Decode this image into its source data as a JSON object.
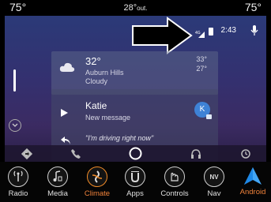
{
  "climate": {
    "left_temp": "75°",
    "right_temp": "75°",
    "outside_temp": "28°",
    "outside_label": "out."
  },
  "status": {
    "network": "4G",
    "time": "2:43"
  },
  "weather_card": {
    "temperature": "32°",
    "location": "Auburn Hills",
    "condition": "Cloudy",
    "high": "33°",
    "low": "27°",
    "icon": "cloud-icon"
  },
  "message_card": {
    "sender": "Katie",
    "subtitle": "New message",
    "avatar_initial": "K",
    "quote": "\"I'm driving right now\""
  },
  "android_nav": [
    "directions-icon",
    "phone-icon",
    "home-icon",
    "headphones-icon",
    "recents-icon"
  ],
  "bottom_bar": {
    "items": [
      {
        "label": "Radio",
        "icon": "radio-icon"
      },
      {
        "label": "Media",
        "icon": "media-icon"
      },
      {
        "label": "Climate",
        "icon": "climate-icon"
      },
      {
        "label": "Apps",
        "icon": "apps-icon"
      },
      {
        "label": "Controls",
        "icon": "controls-icon"
      },
      {
        "label": "Nav",
        "icon": "nav-icon",
        "badge": "NV"
      },
      {
        "label": "Android",
        "icon": "android-auto-icon"
      }
    ]
  },
  "colors": {
    "accent_orange": "#f0823a",
    "android_blue": "#42a5f5",
    "avatar_blue": "#3e82d6"
  }
}
